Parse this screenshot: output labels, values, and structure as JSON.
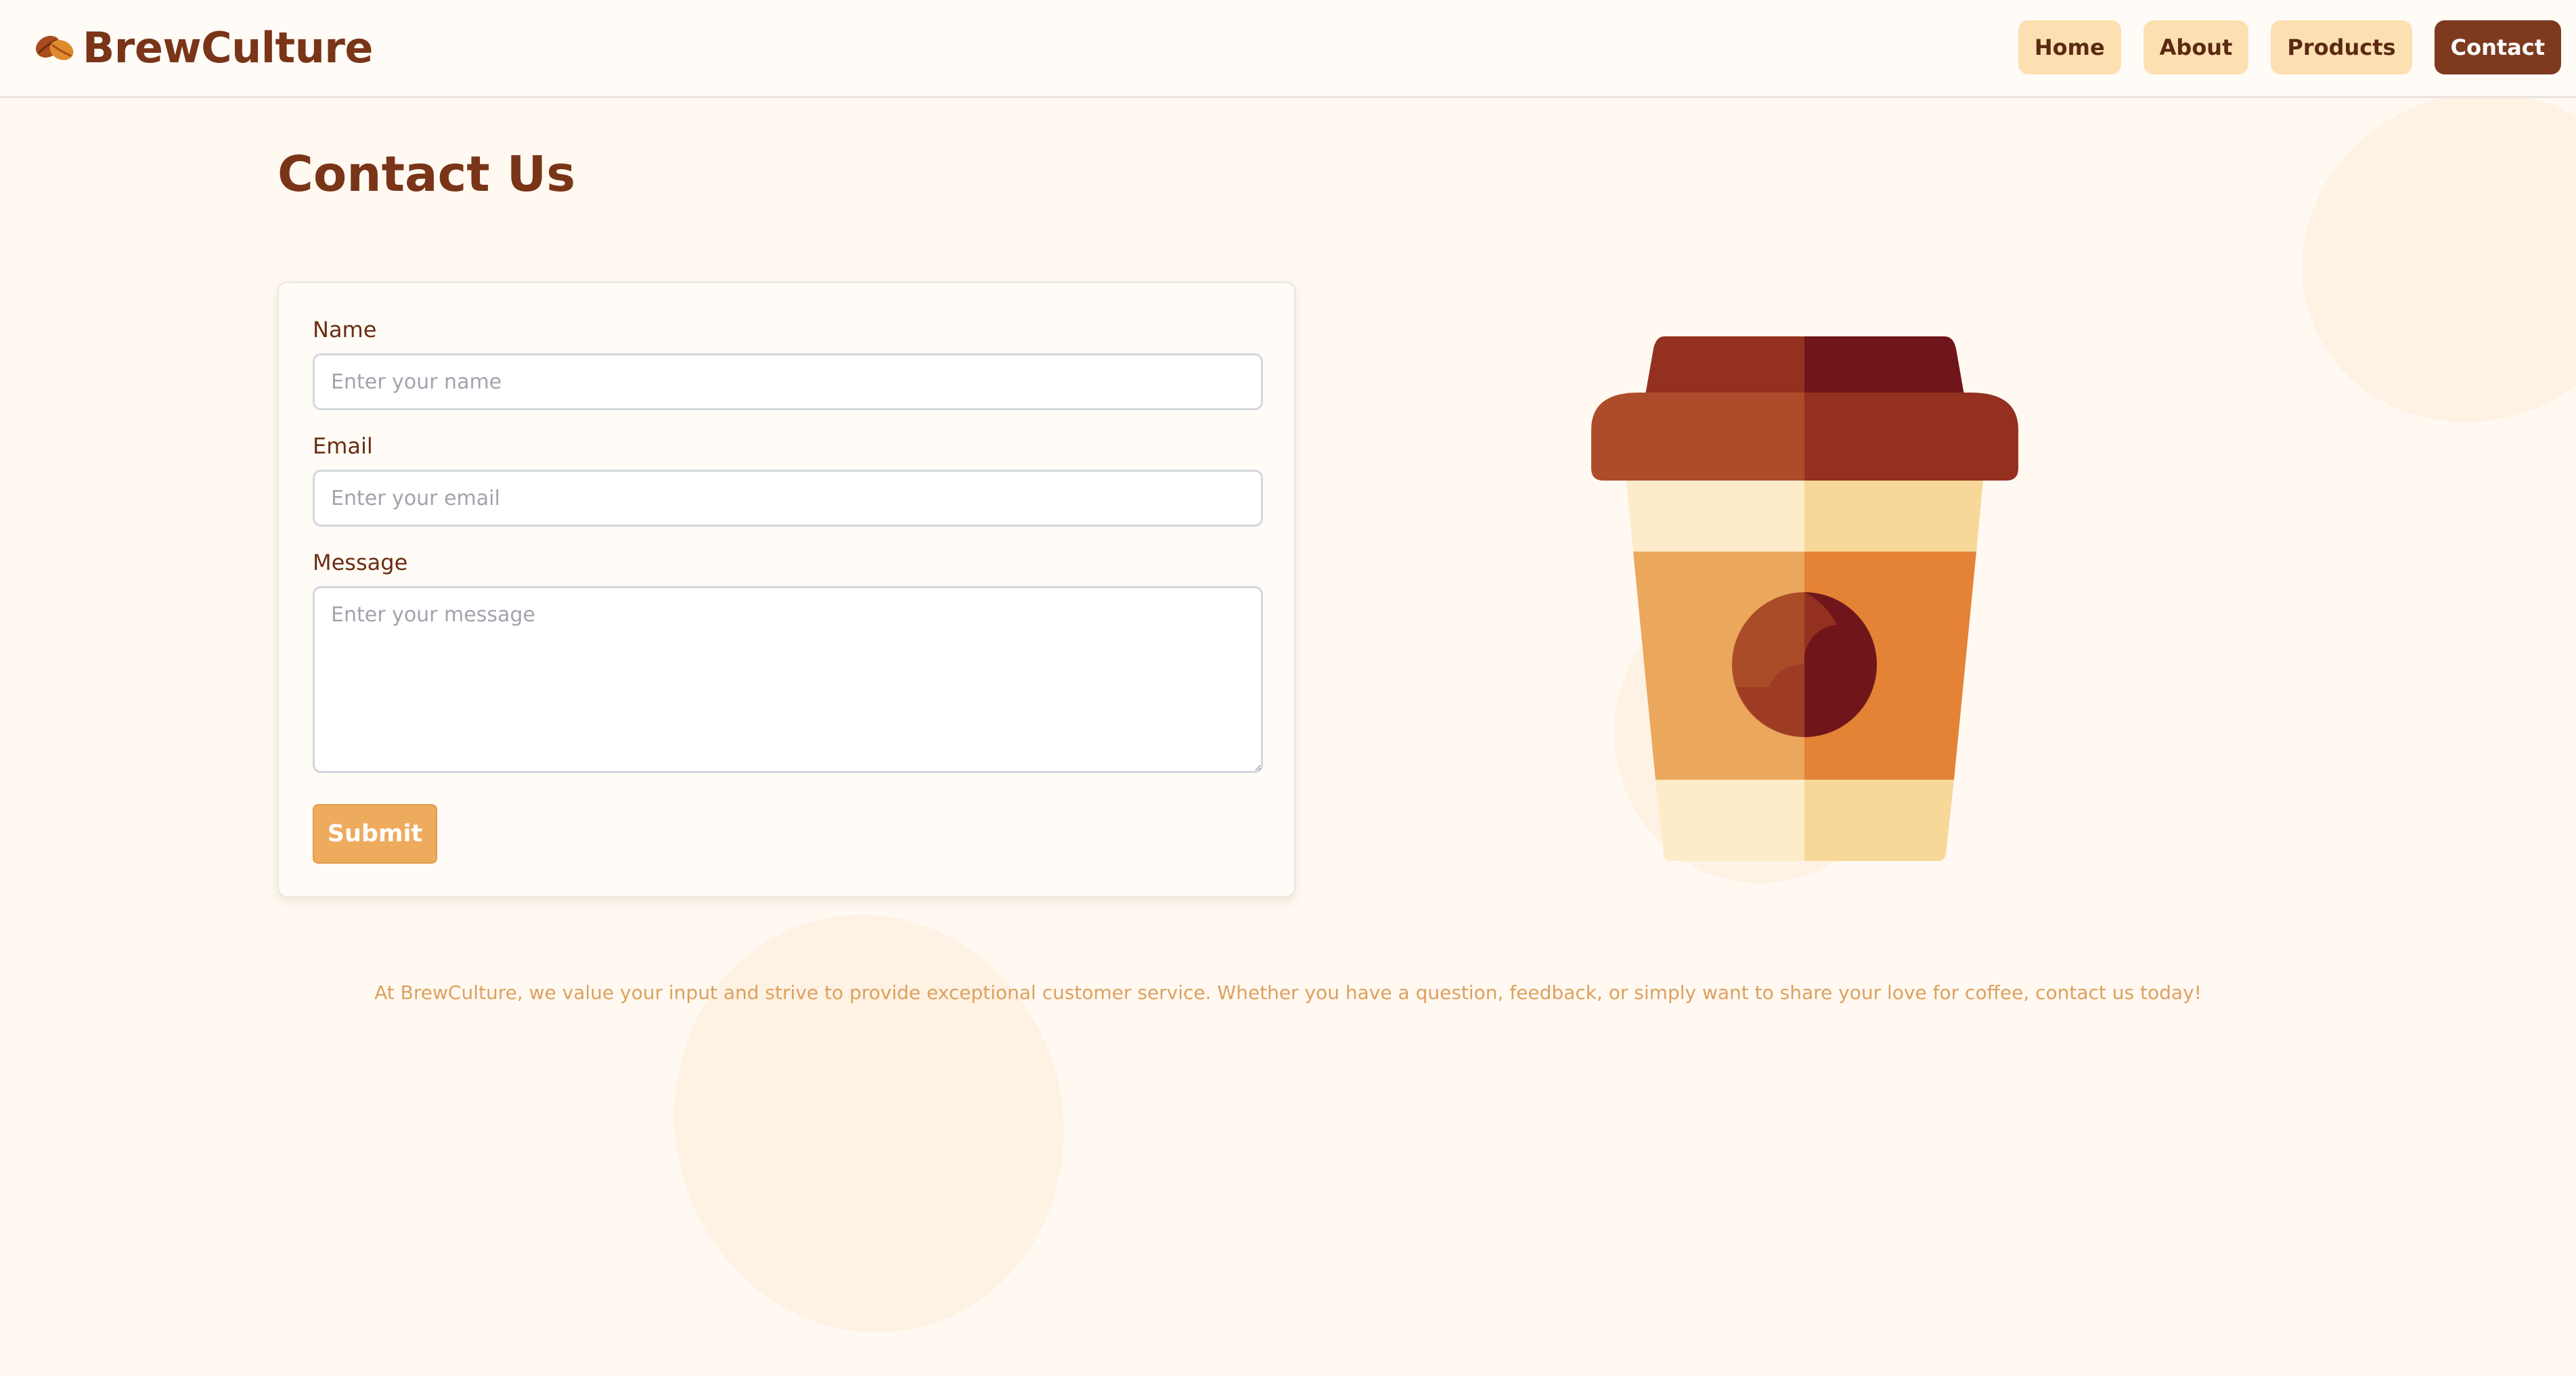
{
  "brand": {
    "name": "BrewCulture",
    "icon": "coffee-bean-icon"
  },
  "nav": {
    "items": [
      {
        "label": "Home",
        "active": false
      },
      {
        "label": "About",
        "active": false
      },
      {
        "label": "Products",
        "active": false
      },
      {
        "label": "Contact",
        "active": true
      }
    ]
  },
  "page": {
    "title": "Contact Us"
  },
  "form": {
    "name_label": "Name",
    "name_placeholder": "Enter your name",
    "name_value": "",
    "email_label": "Email",
    "email_placeholder": "Enter your email",
    "email_value": "",
    "message_label": "Message",
    "message_placeholder": "Enter your message",
    "message_value": "",
    "submit_label": "Submit"
  },
  "illustration": {
    "icon": "coffee-cup-icon"
  },
  "footer": {
    "text": "At BrewCulture, we value your input and strive to provide exceptional customer service. Whether you have a question, feedback, or simply want to share your love for coffee, contact us today!"
  },
  "colors": {
    "background": "#fff9f1",
    "brand_brown": "#7a3418",
    "nav_button": "#fde0b2",
    "nav_active": "#7d3a1f",
    "submit": "#eeab5d",
    "footer_text": "#dda05e"
  }
}
